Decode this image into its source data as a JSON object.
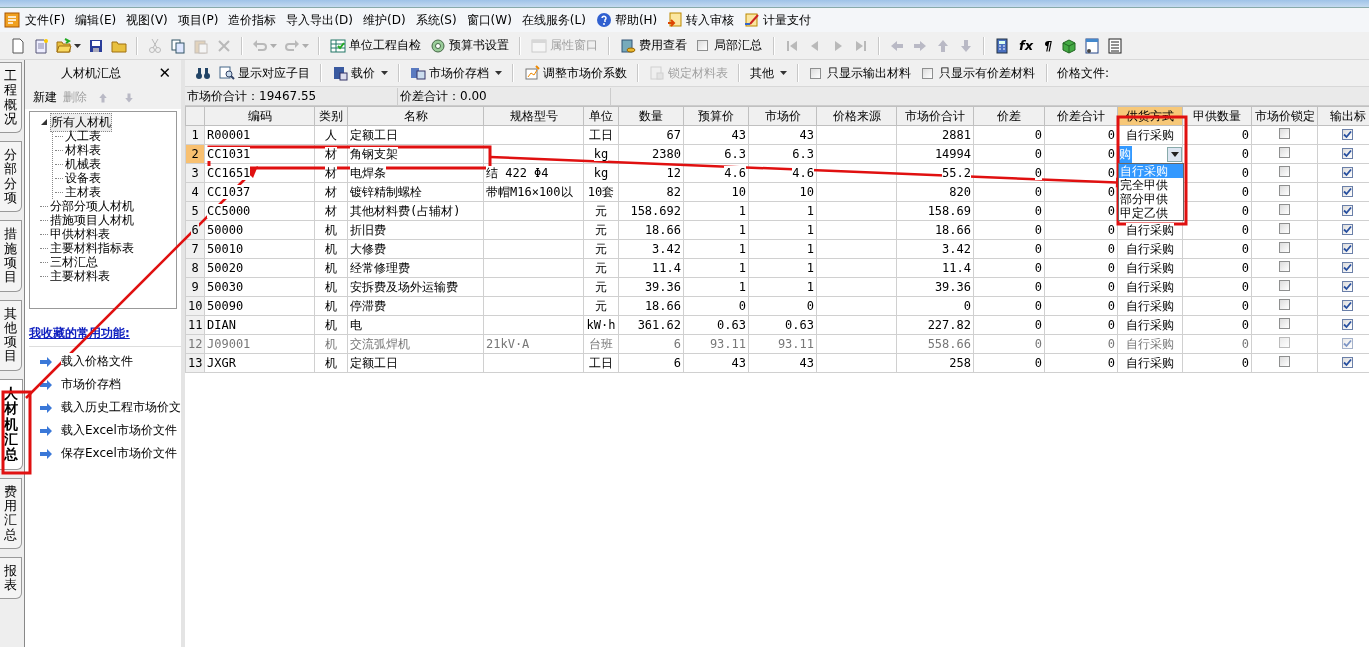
{
  "menu": [
    {
      "label": "文件(F)"
    },
    {
      "label": "编辑(E)"
    },
    {
      "label": "视图(V)"
    },
    {
      "label": "项目(P)"
    },
    {
      "label": "造价指标"
    },
    {
      "label": "导入导出(D)"
    },
    {
      "label": "维护(D)"
    },
    {
      "label": "系统(S)"
    },
    {
      "label": "窗口(W)"
    },
    {
      "label": "在线服务(L)"
    },
    {
      "label": "帮助(H)"
    },
    {
      "label": "转入审核"
    },
    {
      "label": "计量支付"
    }
  ],
  "toolbar": [
    [
      {
        "kind": "icon",
        "disabled": false
      },
      {
        "kind": "icon",
        "disabled": false
      },
      {
        "kind": "dropdown",
        "disabled": false
      },
      {
        "kind": "icon",
        "disabled": false
      },
      {
        "kind": "icon",
        "disabled": false
      }
    ],
    [
      {
        "kind": "icon",
        "disabled": true
      },
      {
        "kind": "icon",
        "disabled": false
      },
      {
        "kind": "icon",
        "disabled": true
      },
      {
        "kind": "icon",
        "disabled": true
      }
    ],
    [
      {
        "kind": "dropdown",
        "disabled": true
      },
      {
        "kind": "dropdown",
        "disabled": true
      }
    ],
    [
      {
        "kind": "button",
        "label": "单位工程自检",
        "disabled": false
      },
      {
        "kind": "button",
        "label": "预算书设置",
        "disabled": false
      }
    ],
    [
      {
        "kind": "button",
        "label": "属性窗口",
        "disabled": true
      }
    ],
    [
      {
        "kind": "button",
        "label": "费用查看",
        "disabled": false
      },
      {
        "kind": "checkbox",
        "label": "局部汇总",
        "checked": false
      }
    ],
    [
      {
        "kind": "icon",
        "disabled": true
      },
      {
        "kind": "icon",
        "disabled": true
      },
      {
        "kind": "icon",
        "disabled": true
      },
      {
        "kind": "icon",
        "disabled": true
      }
    ],
    [
      {
        "kind": "icon",
        "disabled": true
      },
      {
        "kind": "icon",
        "disabled": true
      },
      {
        "kind": "icon",
        "disabled": true
      },
      {
        "kind": "icon",
        "disabled": true
      }
    ],
    [
      {
        "kind": "icon",
        "disabled": false
      },
      {
        "kind": "glyph",
        "label": "fx",
        "disabled": false
      },
      {
        "kind": "glyph",
        "label": "¶",
        "disabled": false
      },
      {
        "kind": "icon",
        "disabled": false
      },
      {
        "kind": "icon",
        "disabled": false
      },
      {
        "kind": "icon",
        "disabled": false
      }
    ]
  ],
  "side_tabs": [
    {
      "label": "工程概况",
      "selected": false
    },
    {
      "label": "分部分项",
      "selected": false
    },
    {
      "label": "措施项目",
      "selected": false
    },
    {
      "label": "其他项目",
      "selected": false
    },
    {
      "label": "人材机汇总",
      "selected": true
    },
    {
      "label": "费用汇总",
      "selected": false
    },
    {
      "label": "报表",
      "selected": false
    }
  ],
  "panel": {
    "title": "人材机汇总",
    "close": "✕",
    "actions": [
      {
        "label": "新建",
        "disabled": false
      },
      {
        "label": "删除",
        "disabled": true
      }
    ],
    "arrows_disabled": true,
    "tree": [
      {
        "label": "所有人材机",
        "expanded": true,
        "selected": true,
        "children": [
          {
            "label": "人工表"
          },
          {
            "label": "材料表"
          },
          {
            "label": "机械表"
          },
          {
            "label": "设备表"
          },
          {
            "label": "主材表"
          }
        ]
      },
      {
        "label": "分部分项人材机"
      },
      {
        "label": "措施项目人材机"
      },
      {
        "label": "甲供材料表"
      },
      {
        "label": "主要材料指标表"
      },
      {
        "label": "三材汇总"
      },
      {
        "label": "主要材料表"
      }
    ],
    "favorites_title": "我收藏的常用功能:",
    "favorites": [
      "载入价格文件",
      "市场价存档",
      "载入历史工程市场价文",
      "载入Excel市场价文件",
      "保存Excel市场价文件"
    ]
  },
  "grid_toolbar": [
    [
      {
        "kind": "icon",
        "disabled": false
      },
      {
        "kind": "button",
        "label": "显示对应子目",
        "disabled": false
      }
    ],
    [
      {
        "kind": "menu",
        "label": "载价",
        "disabled": false
      }
    ],
    [
      {
        "kind": "menu",
        "label": "市场价存档",
        "disabled": false
      }
    ],
    [
      {
        "kind": "button",
        "label": "调整市场价系数",
        "disabled": false
      }
    ],
    [
      {
        "kind": "button",
        "label": "锁定材料表",
        "disabled": true
      }
    ],
    [
      {
        "kind": "menu",
        "label": "其他",
        "disabled": false
      }
    ],
    [
      {
        "kind": "checkbox",
        "label": "只显示输出材料",
        "checked": false
      },
      {
        "kind": "checkbox",
        "label": "只显示有价差材料",
        "checked": false
      }
    ],
    [
      {
        "kind": "label",
        "label": "价格文件:"
      }
    ]
  ],
  "summary": [
    "市场价合计：19467.55",
    "价差合计：0.00"
  ],
  "columns": [
    {
      "selected": false
    },
    {
      "label": "编码",
      "selected": false
    },
    {
      "label": "类别",
      "selected": false
    },
    {
      "label": "名称",
      "selected": false
    },
    {
      "label": "规格型号",
      "selected": false
    },
    {
      "label": "单位",
      "selected": false
    },
    {
      "label": "数量",
      "selected": false
    },
    {
      "label": "预算价",
      "selected": false
    },
    {
      "label": "市场价",
      "selected": false
    },
    {
      "label": "价格来源",
      "selected": false
    },
    {
      "label": "市场价合计",
      "selected": false
    },
    {
      "label": "价差",
      "selected": false
    },
    {
      "label": "价差合计",
      "selected": false
    },
    {
      "label": "供货方式",
      "selected": true
    },
    {
      "label": "甲供数量",
      "selected": false
    },
    {
      "label": "市场价锁定",
      "selected": false
    },
    {
      "label": "输出标",
      "selected": false
    }
  ],
  "rows": [
    {
      "num": "1",
      "code": "R00001",
      "type": "人",
      "name": "定额工日",
      "unit": "工日",
      "qty": "67",
      "budget": "43",
      "market": "43",
      "market_total": "2881",
      "diff": "0",
      "diff_total": "0",
      "supply": "自行采购",
      "owner_qty": "0",
      "locked": false,
      "output": true,
      "selected": false,
      "disabled": false
    },
    {
      "num": "2",
      "code": "CC1031",
      "type": "材",
      "name": "角钢支架",
      "unit": "kg",
      "qty": "2380",
      "budget": "6.3",
      "market": "6.3",
      "market_total": "14994",
      "diff": "0",
      "diff_total": "0",
      "supply_editor": {
        "value": "购",
        "options": [
          {
            "label": "自行采购",
            "selected": true
          },
          {
            "label": "完全甲供",
            "selected": false
          },
          {
            "label": "部分甲供",
            "selected": false
          },
          {
            "label": "甲定乙供",
            "selected": false
          }
        ]
      },
      "owner_qty": "0",
      "locked": false,
      "output": true,
      "selected": true,
      "disabled": false
    },
    {
      "num": "3",
      "code": "CC1651",
      "type": "材",
      "name": "电焊条",
      "spec": "结 422 Φ4",
      "unit": "kg",
      "qty": "12",
      "budget": "4.6",
      "market": "4.6",
      "market_total": "55.2",
      "diff": "0",
      "diff_total": "0",
      "owner_qty": "0",
      "locked": false,
      "output": true,
      "selected": false,
      "disabled": false
    },
    {
      "num": "4",
      "code": "CC1037",
      "type": "材",
      "name": "镀锌精制螺栓",
      "spec": "带帽M16×100以",
      "unit": "10套",
      "qty": "82",
      "budget": "10",
      "market": "10",
      "market_total": "820",
      "diff": "0",
      "diff_total": "0",
      "owner_qty": "0",
      "locked": false,
      "output": true,
      "selected": false,
      "disabled": false
    },
    {
      "num": "5",
      "code": "CC5000",
      "type": "材",
      "name": "其他材料费(占辅材)",
      "unit": "元",
      "qty": "158.692",
      "budget": "1",
      "market": "1",
      "market_total": "158.69",
      "diff": "0",
      "diff_total": "0",
      "owner_qty": "0",
      "locked": false,
      "output": true,
      "selected": false,
      "disabled": false
    },
    {
      "num": "6",
      "code": "50000",
      "type": "机",
      "name": "折旧费",
      "unit": "元",
      "qty": "18.66",
      "budget": "1",
      "market": "1",
      "market_total": "18.66",
      "diff": "0",
      "diff_total": "0",
      "supply": "自行采购",
      "owner_qty": "0",
      "locked": false,
      "output": true,
      "selected": false,
      "disabled": false
    },
    {
      "num": "7",
      "code": "50010",
      "type": "机",
      "name": "大修费",
      "unit": "元",
      "qty": "3.42",
      "budget": "1",
      "market": "1",
      "market_total": "3.42",
      "diff": "0",
      "diff_total": "0",
      "supply": "自行采购",
      "owner_qty": "0",
      "locked": false,
      "output": true,
      "selected": false,
      "disabled": false
    },
    {
      "num": "8",
      "code": "50020",
      "type": "机",
      "name": "经常修理费",
      "unit": "元",
      "qty": "11.4",
      "budget": "1",
      "market": "1",
      "market_total": "11.4",
      "diff": "0",
      "diff_total": "0",
      "supply": "自行采购",
      "owner_qty": "0",
      "locked": false,
      "output": true,
      "selected": false,
      "disabled": false
    },
    {
      "num": "9",
      "code": "50030",
      "type": "机",
      "name": "安拆费及场外运输费",
      "unit": "元",
      "qty": "39.36",
      "budget": "1",
      "market": "1",
      "market_total": "39.36",
      "diff": "0",
      "diff_total": "0",
      "supply": "自行采购",
      "owner_qty": "0",
      "locked": false,
      "output": true,
      "selected": false,
      "disabled": false
    },
    {
      "num": "10",
      "code": "50090",
      "type": "机",
      "name": "停滞费",
      "unit": "元",
      "qty": "18.66",
      "budget": "0",
      "market": "0",
      "market_total": "0",
      "diff": "0",
      "diff_total": "0",
      "supply": "自行采购",
      "owner_qty": "0",
      "locked": false,
      "output": true,
      "selected": false,
      "disabled": false
    },
    {
      "num": "11",
      "code": "DIAN",
      "type": "机",
      "name": "电",
      "unit": "kW·h",
      "qty": "361.62",
      "budget": "0.63",
      "market": "0.63",
      "market_total": "227.82",
      "diff": "0",
      "diff_total": "0",
      "supply": "自行采购",
      "owner_qty": "0",
      "locked": false,
      "output": true,
      "selected": false,
      "disabled": false
    },
    {
      "num": "12",
      "code": "J09001",
      "type": "机",
      "name": "交流弧焊机",
      "spec": "21kV·A",
      "unit": "台班",
      "qty": "6",
      "budget": "93.11",
      "market": "93.11",
      "market_total": "558.66",
      "diff": "0",
      "diff_total": "0",
      "supply": "自行采购",
      "owner_qty": "0",
      "locked": false,
      "output": true,
      "selected": false,
      "disabled": true
    },
    {
      "num": "13",
      "code": "JXGR",
      "type": "机",
      "name": "定额工日",
      "unit": "工日",
      "qty": "6",
      "budget": "43",
      "market": "43",
      "market_total": "258",
      "diff": "0",
      "diff_total": "0",
      "supply": "自行采购",
      "owner_qty": "0",
      "locked": false,
      "output": true,
      "selected": false,
      "disabled": false
    }
  ]
}
